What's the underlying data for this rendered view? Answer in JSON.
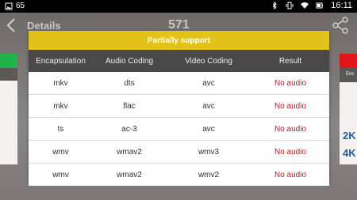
{
  "status_bar": {
    "battery_text": "65",
    "time": "16:11"
  },
  "app_bar": {
    "title": "Details",
    "count": "571"
  },
  "background": {
    "right_header_fragment": "Enc",
    "right_rows": [
      "2K",
      "4K"
    ]
  },
  "dialog": {
    "title": "Partially support",
    "headers": [
      "Encapsulation",
      "Audio Coding",
      "Video Coding",
      "Result"
    ],
    "rows": [
      [
        "mkv",
        "dts",
        "avc",
        "No audio"
      ],
      [
        "mkv",
        "flac",
        "avc",
        "No audio"
      ],
      [
        "ts",
        "ac-3",
        "avc",
        "No audio"
      ],
      [
        "wmv",
        "wmav2",
        "wmv3",
        "No audio"
      ],
      [
        "wmv",
        "wmav2",
        "wmv2",
        "No audio"
      ]
    ]
  },
  "colors": {
    "dialog_header": "#e3c21a",
    "table_header": "#4a4848",
    "result_text": "#d0121a",
    "green_tab": "#1fb34a",
    "red_tab": "#e0161c"
  }
}
